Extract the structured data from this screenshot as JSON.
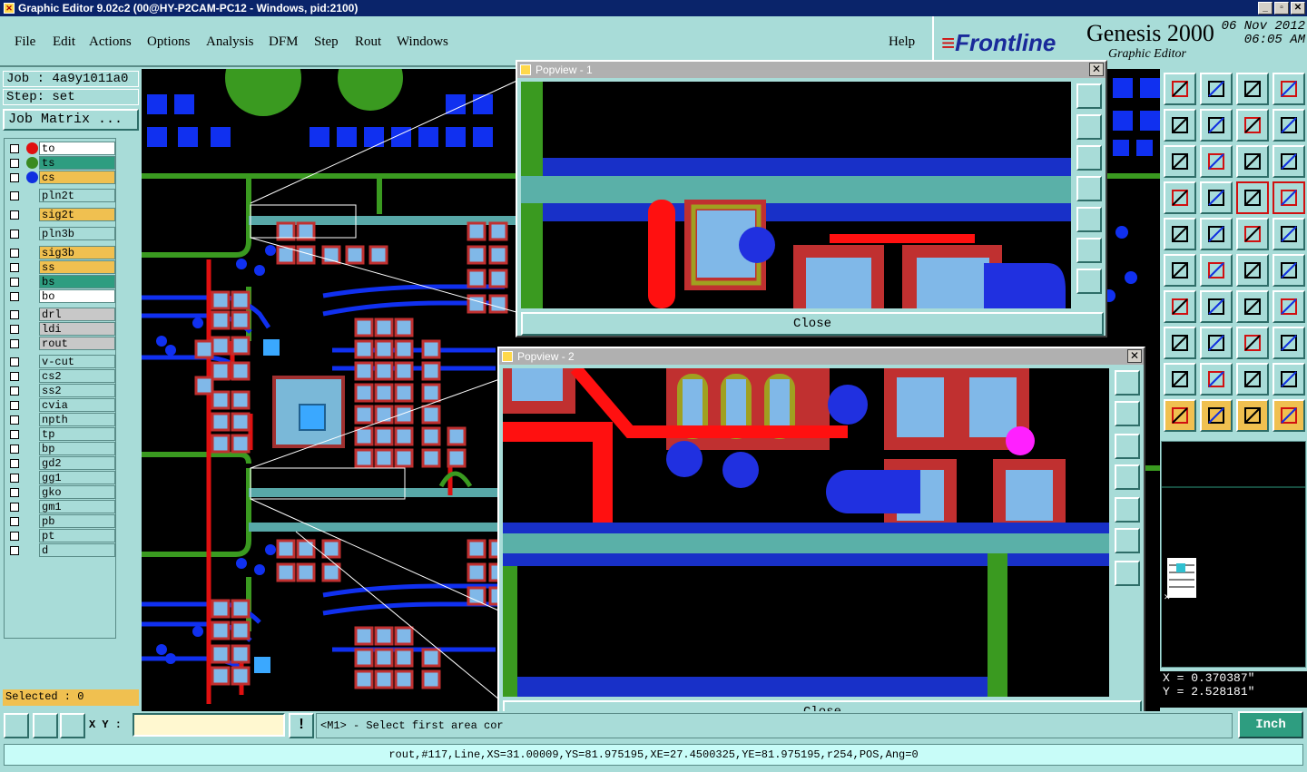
{
  "window": {
    "title": "Graphic Editor 9.02c2 (00@HY-P2CAM-PC12 - Windows, pid:2100)"
  },
  "menu": {
    "items": [
      "File",
      "Edit",
      "Actions",
      "Options",
      "Analysis",
      "DFM",
      "Step",
      "Rout",
      "Windows"
    ],
    "help": "Help"
  },
  "brand": {
    "logo": "Frontline",
    "product": "Genesis 2000",
    "subtitle": "Graphic Editor",
    "date": "06 Nov 2012",
    "time": "06:05 AM"
  },
  "job": {
    "job_label": "Job : 4a9y1011a0",
    "step_label": "Step: set",
    "matrix_button": "Job Matrix ..."
  },
  "layers": [
    {
      "name": "to",
      "color": "#ffffff",
      "dot": "#e01010"
    },
    {
      "name": "ts",
      "color": "#2e9d80",
      "dot": "#3a8a20"
    },
    {
      "name": "cs",
      "color": "#f0c050",
      "dot": "#1030e0"
    },
    {
      "name": "pln2t",
      "color": "#a8dcd8"
    },
    {
      "name": "sig2t",
      "color": "#f0c050"
    },
    {
      "name": "pln3b",
      "color": "#a8dcd8"
    },
    {
      "name": "sig3b",
      "color": "#f0c050"
    },
    {
      "name": "ss",
      "color": "#f0c050"
    },
    {
      "name": "bs",
      "color": "#2e9d80"
    },
    {
      "name": "bo",
      "color": "#ffffff"
    },
    {
      "name": "drl",
      "color": "#c8c8c8"
    },
    {
      "name": "ldi",
      "color": "#c8c8c8"
    },
    {
      "name": "rout",
      "color": "#c8c8c8"
    },
    {
      "name": "v-cut",
      "color": "#a8dcd8"
    },
    {
      "name": "cs2",
      "color": "#a8dcd8"
    },
    {
      "name": "ss2",
      "color": "#a8dcd8"
    },
    {
      "name": "cvia",
      "color": "#a8dcd8"
    },
    {
      "name": "npth",
      "color": "#a8dcd8"
    },
    {
      "name": "tp",
      "color": "#a8dcd8"
    },
    {
      "name": "bp",
      "color": "#a8dcd8"
    },
    {
      "name": "gd2",
      "color": "#a8dcd8"
    },
    {
      "name": "gg1",
      "color": "#a8dcd8"
    },
    {
      "name": "gko",
      "color": "#a8dcd8"
    },
    {
      "name": "gm1",
      "color": "#a8dcd8"
    },
    {
      "name": "pb",
      "color": "#a8dcd8"
    },
    {
      "name": "pt",
      "color": "#a8dcd8"
    },
    {
      "name": "d",
      "color": "#a8dcd8"
    }
  ],
  "selected": "Selected : 0",
  "popview1": {
    "title": "Popview - 1",
    "close": "Close"
  },
  "popview2": {
    "title": "Popview - 2",
    "close": "Close"
  },
  "coords": {
    "x": "X = 0.370387\"",
    "y": "Y = 2.528181\""
  },
  "bottom": {
    "xy_label": "X Y :",
    "xy_value": "",
    "message": "<M1> - Select first area cor",
    "unit": "Inch"
  },
  "status": "rout,#117,Line,XS=31.00009,YS=81.975195,XE=27.4500325,YE=81.975195,r254,POS,Ang=0"
}
